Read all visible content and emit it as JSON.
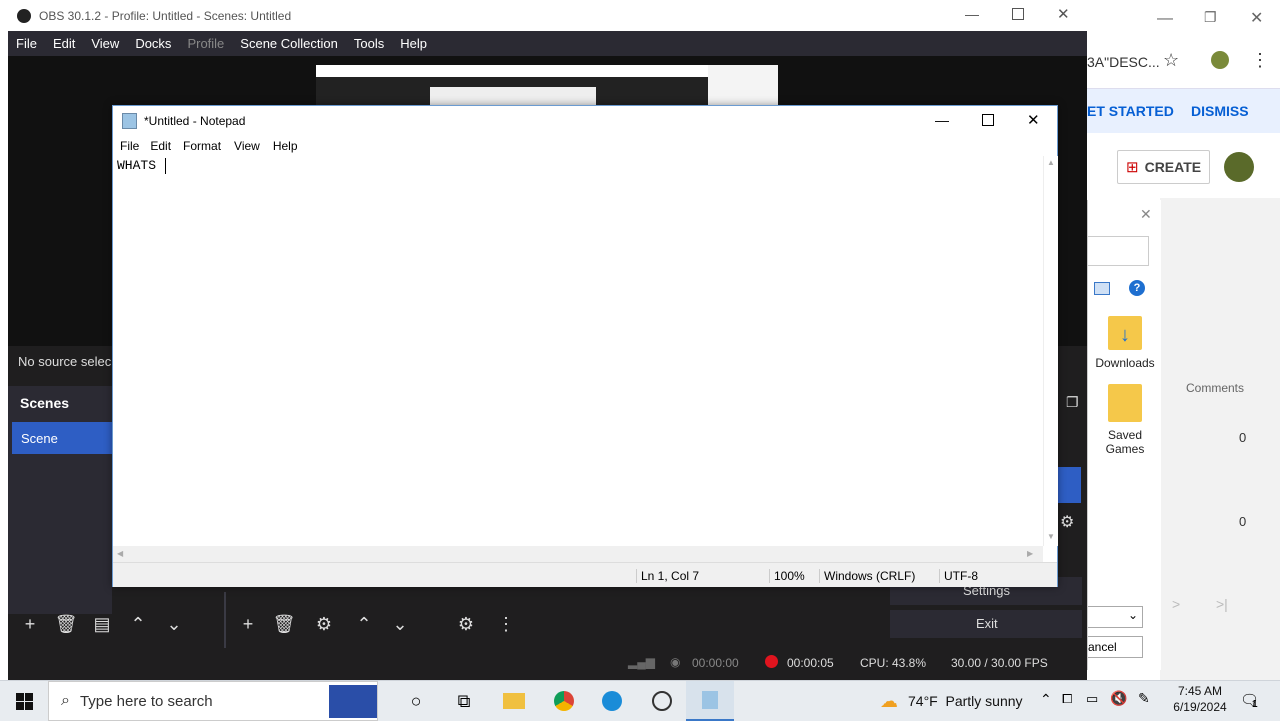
{
  "obs": {
    "title": "OBS 30.1.2 - Profile: Untitled - Scenes: Untitled",
    "menu": [
      "File",
      "Edit",
      "View",
      "Docks",
      "Profile",
      "Scene Collection",
      "Tools",
      "Help"
    ],
    "no_source": "No source selec",
    "scenes_header": "Scenes",
    "scene_item": "Scene",
    "settings_label": "Settings",
    "exit_label": "Exit",
    "status": {
      "stream_time": "00:00:00",
      "rec_time": "00:00:05",
      "cpu": "CPU: 43.8%",
      "fps": "30.00 / 30.00 FPS"
    }
  },
  "chrome": {
    "omnibox_fragment": "3A\"DESC...",
    "banner_get_started": "ET STARTED",
    "banner_dismiss": "DISMISS",
    "create_label": "CREATE",
    "comments_header": "Comments",
    "comments_values": [
      "0",
      "0"
    ]
  },
  "explorer": {
    "downloads": "Downloads",
    "saved_games_line1": "Saved",
    "saved_games_line2": "Games",
    "cancel_fragment": "ancel"
  },
  "notepad": {
    "title": "*Untitled - Notepad",
    "menu": [
      "File",
      "Edit",
      "Format",
      "View",
      "Help"
    ],
    "content": "WHATS ",
    "status": {
      "position": "Ln 1, Col 7",
      "zoom": "100%",
      "line_endings": "Windows (CRLF)",
      "encoding": "UTF-8"
    }
  },
  "taskbar": {
    "search_placeholder": "Type here to search",
    "weather": "74°F  Partly sunny",
    "time": "7:45 AM",
    "date": "6/19/2024",
    "notification_count": "1"
  }
}
